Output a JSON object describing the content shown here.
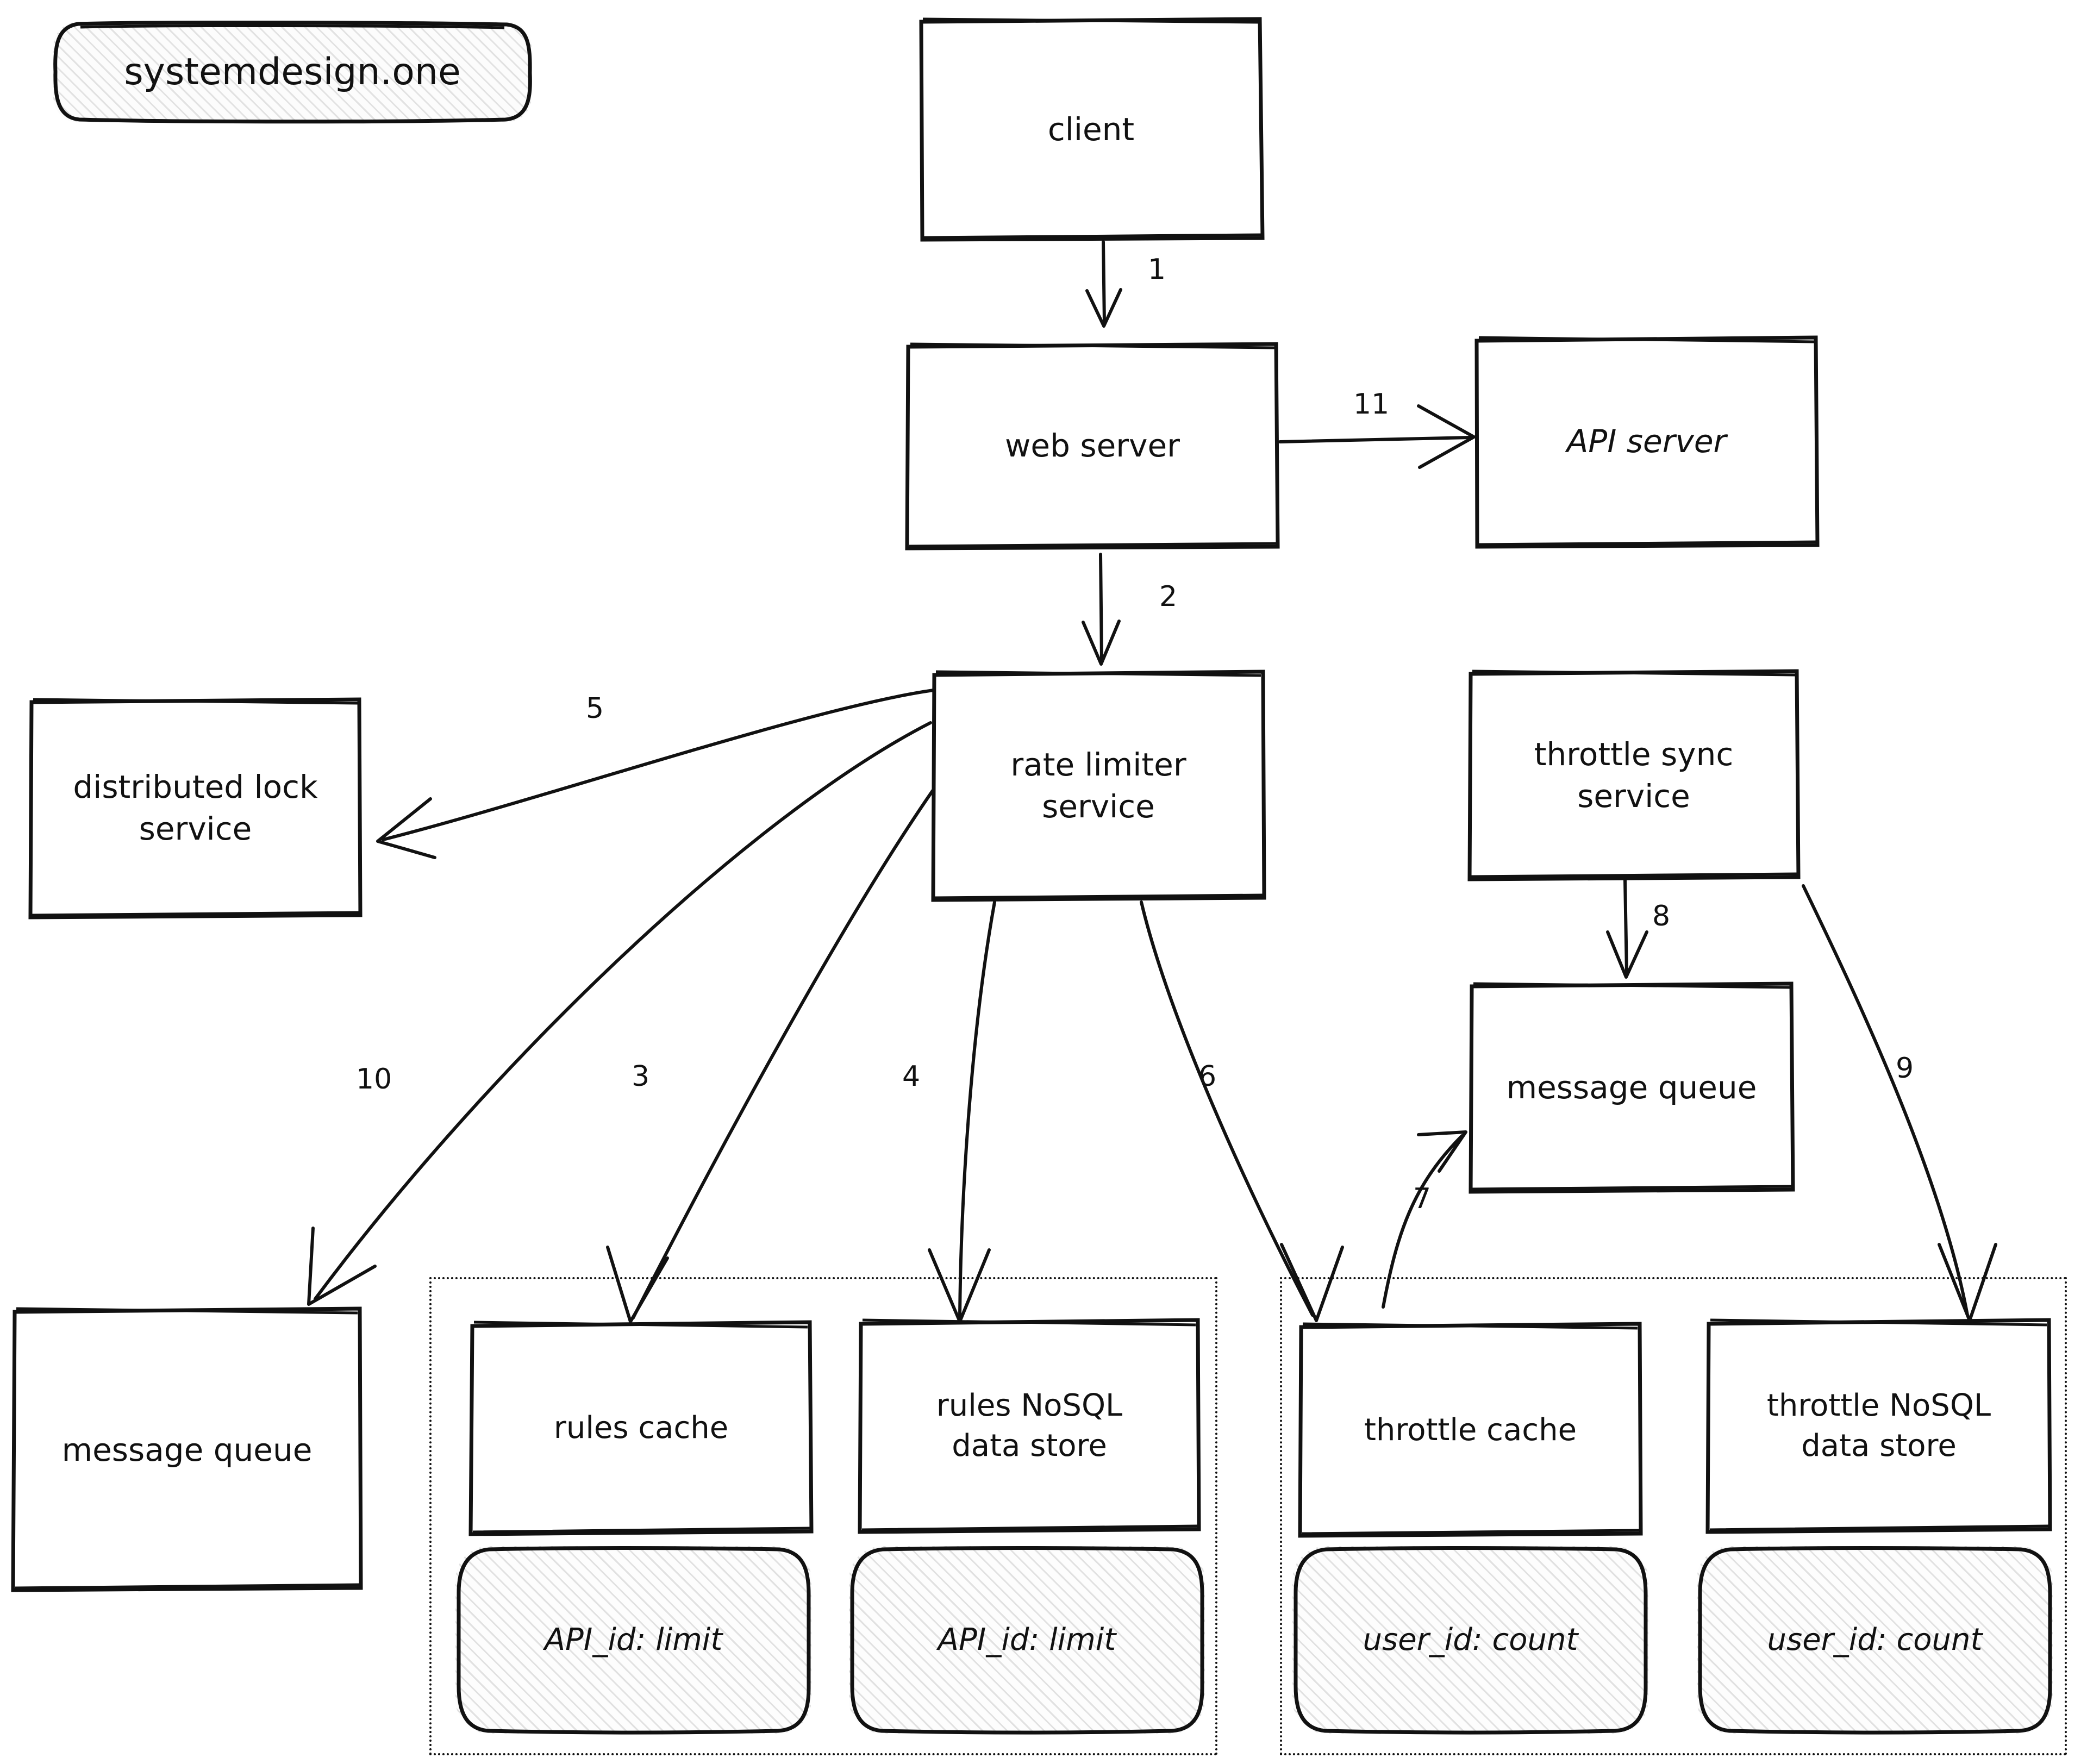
{
  "logo": {
    "text": "systemdesign.one"
  },
  "nodes": {
    "client": {
      "label": "client"
    },
    "web_server": {
      "label": "web server"
    },
    "api_server": {
      "label": "API server"
    },
    "rate_limiter": {
      "label": "rate limiter\nservice"
    },
    "throttle_sync": {
      "label": "throttle sync\nservice"
    },
    "distributed_lock": {
      "label": "distributed lock\nservice"
    },
    "message_queue_left": {
      "label": "message queue"
    },
    "message_queue_right": {
      "label": "message queue"
    },
    "rules_cache": {
      "label": "rules cache"
    },
    "rules_store": {
      "label": "rules NoSQL\ndata store"
    },
    "throttle_cache": {
      "label": "throttle cache"
    },
    "throttle_store": {
      "label": "throttle NoSQL\ndata store"
    }
  },
  "data_boxes": {
    "rules_cache_data": {
      "label": "API_id: limit"
    },
    "rules_store_data": {
      "label": "API_id: limit"
    },
    "throttle_cache_data": {
      "label": "user_id: count"
    },
    "throttle_store_data": {
      "label": "user_id: count"
    }
  },
  "edges": [
    {
      "id": "e1",
      "label": "1",
      "from": "client",
      "to": "web_server"
    },
    {
      "id": "e2",
      "label": "2",
      "from": "web_server",
      "to": "rate_limiter"
    },
    {
      "id": "e3",
      "label": "3",
      "from": "rate_limiter",
      "to": "rules_cache"
    },
    {
      "id": "e4",
      "label": "4",
      "from": "rate_limiter",
      "to": "rules_store"
    },
    {
      "id": "e5",
      "label": "5",
      "from": "rate_limiter",
      "to": "distributed_lock"
    },
    {
      "id": "e6",
      "label": "6",
      "from": "rate_limiter",
      "to": "throttle_cache"
    },
    {
      "id": "e7",
      "label": "7",
      "from": "throttle_cache",
      "to": "message_queue_right"
    },
    {
      "id": "e8",
      "label": "8",
      "from": "throttle_sync",
      "to": "message_queue_right"
    },
    {
      "id": "e9",
      "label": "9",
      "from": "throttle_sync",
      "to": "throttle_store"
    },
    {
      "id": "e10",
      "label": "10",
      "from": "rate_limiter",
      "to": "message_queue_left"
    },
    {
      "id": "e11",
      "label": "11",
      "from": "web_server",
      "to": "api_server"
    }
  ],
  "colors": {
    "stroke": "#111111",
    "background": "#ffffff",
    "hatch": "#e8e8e8"
  }
}
